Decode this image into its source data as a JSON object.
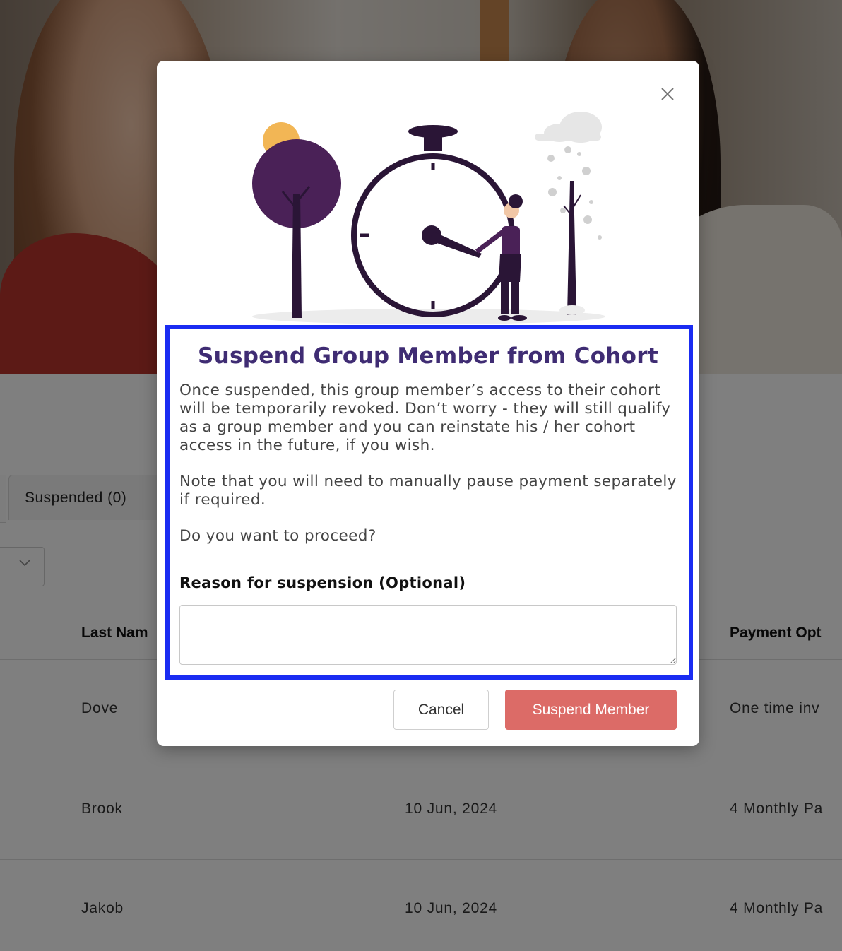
{
  "background": {
    "tabs": {
      "suspended_label": "Suspended (0)"
    },
    "table": {
      "headers": {
        "last_name": "Last Nam",
        "payment_option": "Payment Opt"
      },
      "rows": [
        {
          "last_name": "Dove",
          "date": "",
          "payment": "One time inv"
        },
        {
          "last_name": "Brook",
          "date": "10 Jun, 2024",
          "payment": "4 Monthly Pa"
        },
        {
          "last_name": "Jakob",
          "date": "10 Jun, 2024",
          "payment": "4 Monthly Pa"
        }
      ]
    }
  },
  "modal": {
    "title": "Suspend Group Member from Cohort",
    "paragraph_1": "Once suspended, this group member’s access to their cohort will be temporarily revoked. Don’t worry - they will still qualify as a group member and you can reinstate his / her cohort access in the future, if you wish.",
    "paragraph_2": "Note that you will need to manually pause payment separately if required.",
    "paragraph_3": "Do you want to proceed?",
    "reason_label": "Reason for suspension (Optional)",
    "reason_value": "",
    "cancel_label": "Cancel",
    "suspend_label": "Suspend Member",
    "icons": {
      "close": "close-icon",
      "illustration": "stopwatch-illustration"
    }
  },
  "colors": {
    "title": "#3f2c73",
    "suspend_button": "#dc6b67",
    "highlight": "#1a2cf2",
    "illustration_purple": "#4a2157",
    "clock_dark": "#2a1536",
    "sun": "#f2b655"
  }
}
